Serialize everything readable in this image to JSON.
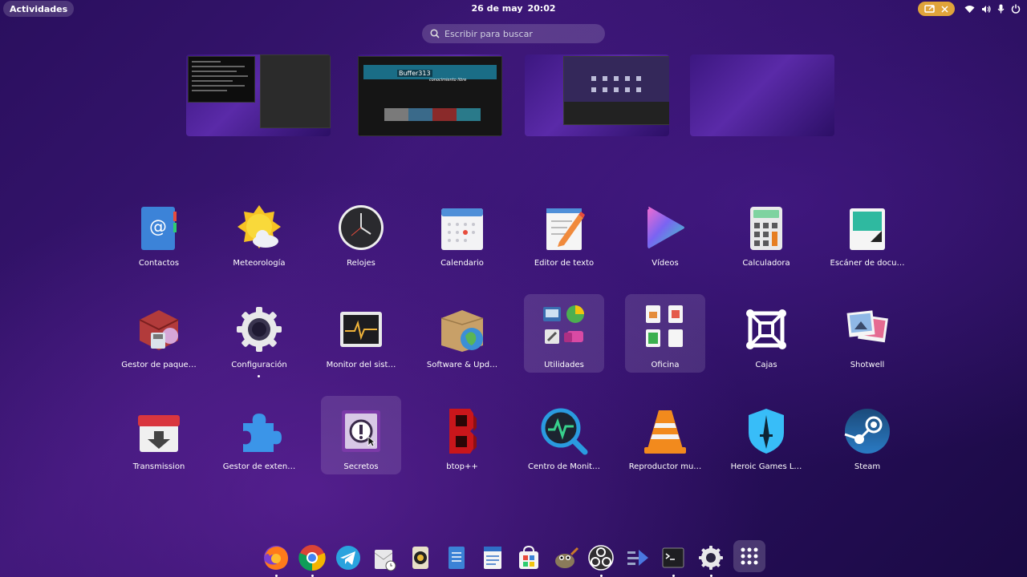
{
  "topbar": {
    "activities": "Actividades",
    "date": "26 de may",
    "time": "20:02"
  },
  "search": {
    "placeholder": "Escribir para buscar"
  },
  "workspaces": [
    {
      "name": "workspace-1"
    },
    {
      "name": "workspace-2",
      "banner_title": "Buffer313",
      "banner_subtitle": "conocimiento libre"
    },
    {
      "name": "workspace-3"
    },
    {
      "name": "workspace-4"
    }
  ],
  "apps": [
    {
      "label": "Contactos",
      "icon": "contacts-icon"
    },
    {
      "label": "Meteorología",
      "icon": "weather-icon"
    },
    {
      "label": "Relojes",
      "icon": "clock-icon"
    },
    {
      "label": "Calendario",
      "icon": "calendar-icon"
    },
    {
      "label": "Editor de texto",
      "icon": "text-editor-icon"
    },
    {
      "label": "Vídeos",
      "icon": "videos-icon"
    },
    {
      "label": "Calculadora",
      "icon": "calculator-icon"
    },
    {
      "label": "Escáner de docu…",
      "icon": "scanner-icon"
    },
    {
      "label": "Gestor de paque…",
      "icon": "package-manager-icon"
    },
    {
      "label": "Configuración",
      "icon": "settings-icon"
    },
    {
      "label": "Monitor del sist…",
      "icon": "system-monitor-icon"
    },
    {
      "label": "Software & Upd…",
      "icon": "software-updates-icon"
    },
    {
      "label": "Utilidades",
      "icon": "utilities-folder-icon"
    },
    {
      "label": "Oficina",
      "icon": "office-folder-icon"
    },
    {
      "label": "Cajas",
      "icon": "boxes-icon"
    },
    {
      "label": "Shotwell",
      "icon": "shotwell-icon"
    },
    {
      "label": "Transmission",
      "icon": "transmission-icon"
    },
    {
      "label": "Gestor de exten…",
      "icon": "extensions-icon"
    },
    {
      "label": "Secretos",
      "icon": "secrets-icon"
    },
    {
      "label": "btop++",
      "icon": "btop-icon"
    },
    {
      "label": "Centro de Monit…",
      "icon": "monitor-center-icon"
    },
    {
      "label": "Reproductor mu…",
      "icon": "vlc-icon"
    },
    {
      "label": "Heroic Games L…",
      "icon": "heroic-icon"
    },
    {
      "label": "Steam",
      "icon": "steam-icon"
    }
  ],
  "dock": [
    {
      "icon": "firefox-icon"
    },
    {
      "icon": "chrome-icon"
    },
    {
      "icon": "telegram-icon"
    },
    {
      "icon": "mail-icon"
    },
    {
      "icon": "audio-player-icon"
    },
    {
      "icon": "text-editor-icon"
    },
    {
      "icon": "writer-icon"
    },
    {
      "icon": "software-store-icon"
    },
    {
      "icon": "gimp-icon"
    },
    {
      "icon": "obs-icon"
    },
    {
      "icon": "flow-icon"
    },
    {
      "icon": "terminal-icon"
    },
    {
      "icon": "settings-icon"
    },
    {
      "icon": "app-grid-icon"
    }
  ],
  "colors": {
    "accent_indicator": "#e0a43a",
    "background_dark": "#1a0a44",
    "background_mid": "#3a1673"
  }
}
